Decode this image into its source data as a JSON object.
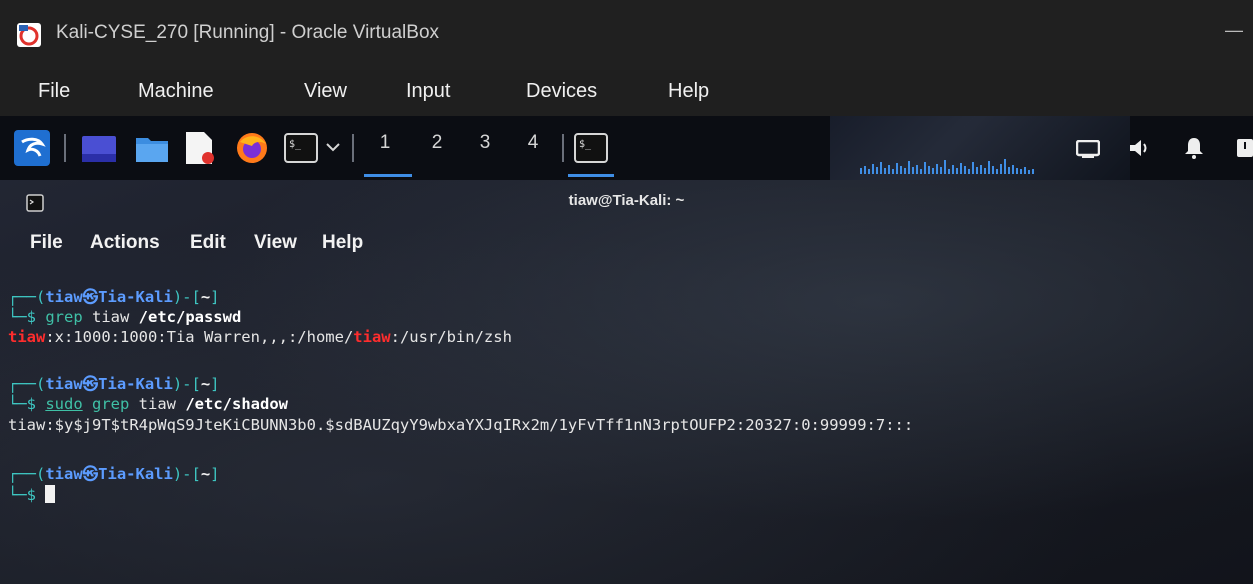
{
  "window": {
    "title": "Kali-CYSE_270 [Running] - Oracle VirtualBox",
    "minimize_glyph": "—"
  },
  "vbox_menu": [
    "File",
    "Machine",
    "View",
    "Input",
    "Devices",
    "Help"
  ],
  "panel": {
    "workspaces": [
      "1",
      "2",
      "3",
      "4"
    ],
    "icons": [
      "kali-menu-icon",
      "desktop-icon",
      "file-manager-icon",
      "text-editor-icon",
      "firefox-icon",
      "terminal-icon",
      "dropdown-icon",
      "terminal-task-icon",
      "display-icon",
      "volume-icon",
      "notification-bell-icon",
      "power-icon"
    ]
  },
  "terminal": {
    "title": "tiaw@Tia-Kali: ~",
    "menu": [
      "File",
      "Actions",
      "Edit",
      "View",
      "Help"
    ],
    "prompt": {
      "open": "┌──(",
      "user": "tiaw",
      "at": "㉿",
      "host": "Tia-Kali",
      "mid": ")-[",
      "dir": "~",
      "close": "]",
      "arrow": "└─$ "
    },
    "cmd1": {
      "program": "grep",
      "args": " tiaw ",
      "target": "/etc/passwd"
    },
    "out1": {
      "match1": "tiaw",
      "part1": ":x:1000:1000:Tia Warren,,,:/home/",
      "match2": "tiaw",
      "part2": ":/usr/bin/zsh"
    },
    "cmd2": {
      "sudo": "sudo",
      "program": "grep",
      "args": " tiaw ",
      "target": "/etc/shadow"
    },
    "out2": "tiaw:$y$j9T$tR4pWqS9JteKiCBUNN3b0.$sdBAUZqyY9wbxaYXJqIRx2m/1yFvTff1nN3rptOUFP2:20327:0:99999:7:::"
  },
  "colors": {
    "prompt_frame": "#3ec6c2",
    "user_host": "#5c9cff",
    "grep_match": "#ff2d2d",
    "workspace_active": "#3f8ee6"
  }
}
